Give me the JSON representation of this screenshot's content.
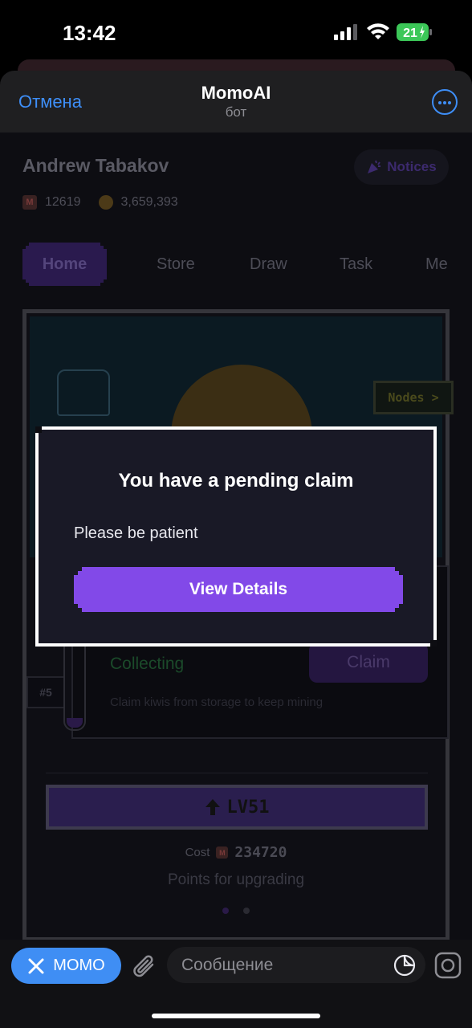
{
  "status_bar": {
    "time": "13:42",
    "battery": "21"
  },
  "telegram": {
    "cancel_label": "Отмена",
    "bot_name": "MomoAI",
    "bot_subtitle": "бот"
  },
  "profile": {
    "name": "Andrew Tabakov",
    "notices_label": "Notices",
    "momo_points": "12619",
    "kiwis": "3,659,393"
  },
  "tabs": [
    {
      "label": "Home",
      "active": true
    },
    {
      "label": "Store"
    },
    {
      "label": "Draw"
    },
    {
      "label": "Task"
    },
    {
      "label": "Me"
    }
  ],
  "game": {
    "nodes_label": "Nodes >",
    "rank_tag": "#5",
    "collecting_label": "Collecting",
    "claim_label": "Claim",
    "claim_hint": "Claim kiwis from storage to keep mining",
    "level_label": "LV51",
    "cost_label": "Cost",
    "cost_value": "234720",
    "points_label": "Points for upgrading"
  },
  "modal": {
    "title": "You have a pending claim",
    "body": "Please be patient",
    "button": "View Details"
  },
  "composer": {
    "momo_label": "MOMO",
    "placeholder": "Сообщение"
  },
  "colors": {
    "accent_blue": "#3e8ef7",
    "modal_button": "#8249e8"
  }
}
